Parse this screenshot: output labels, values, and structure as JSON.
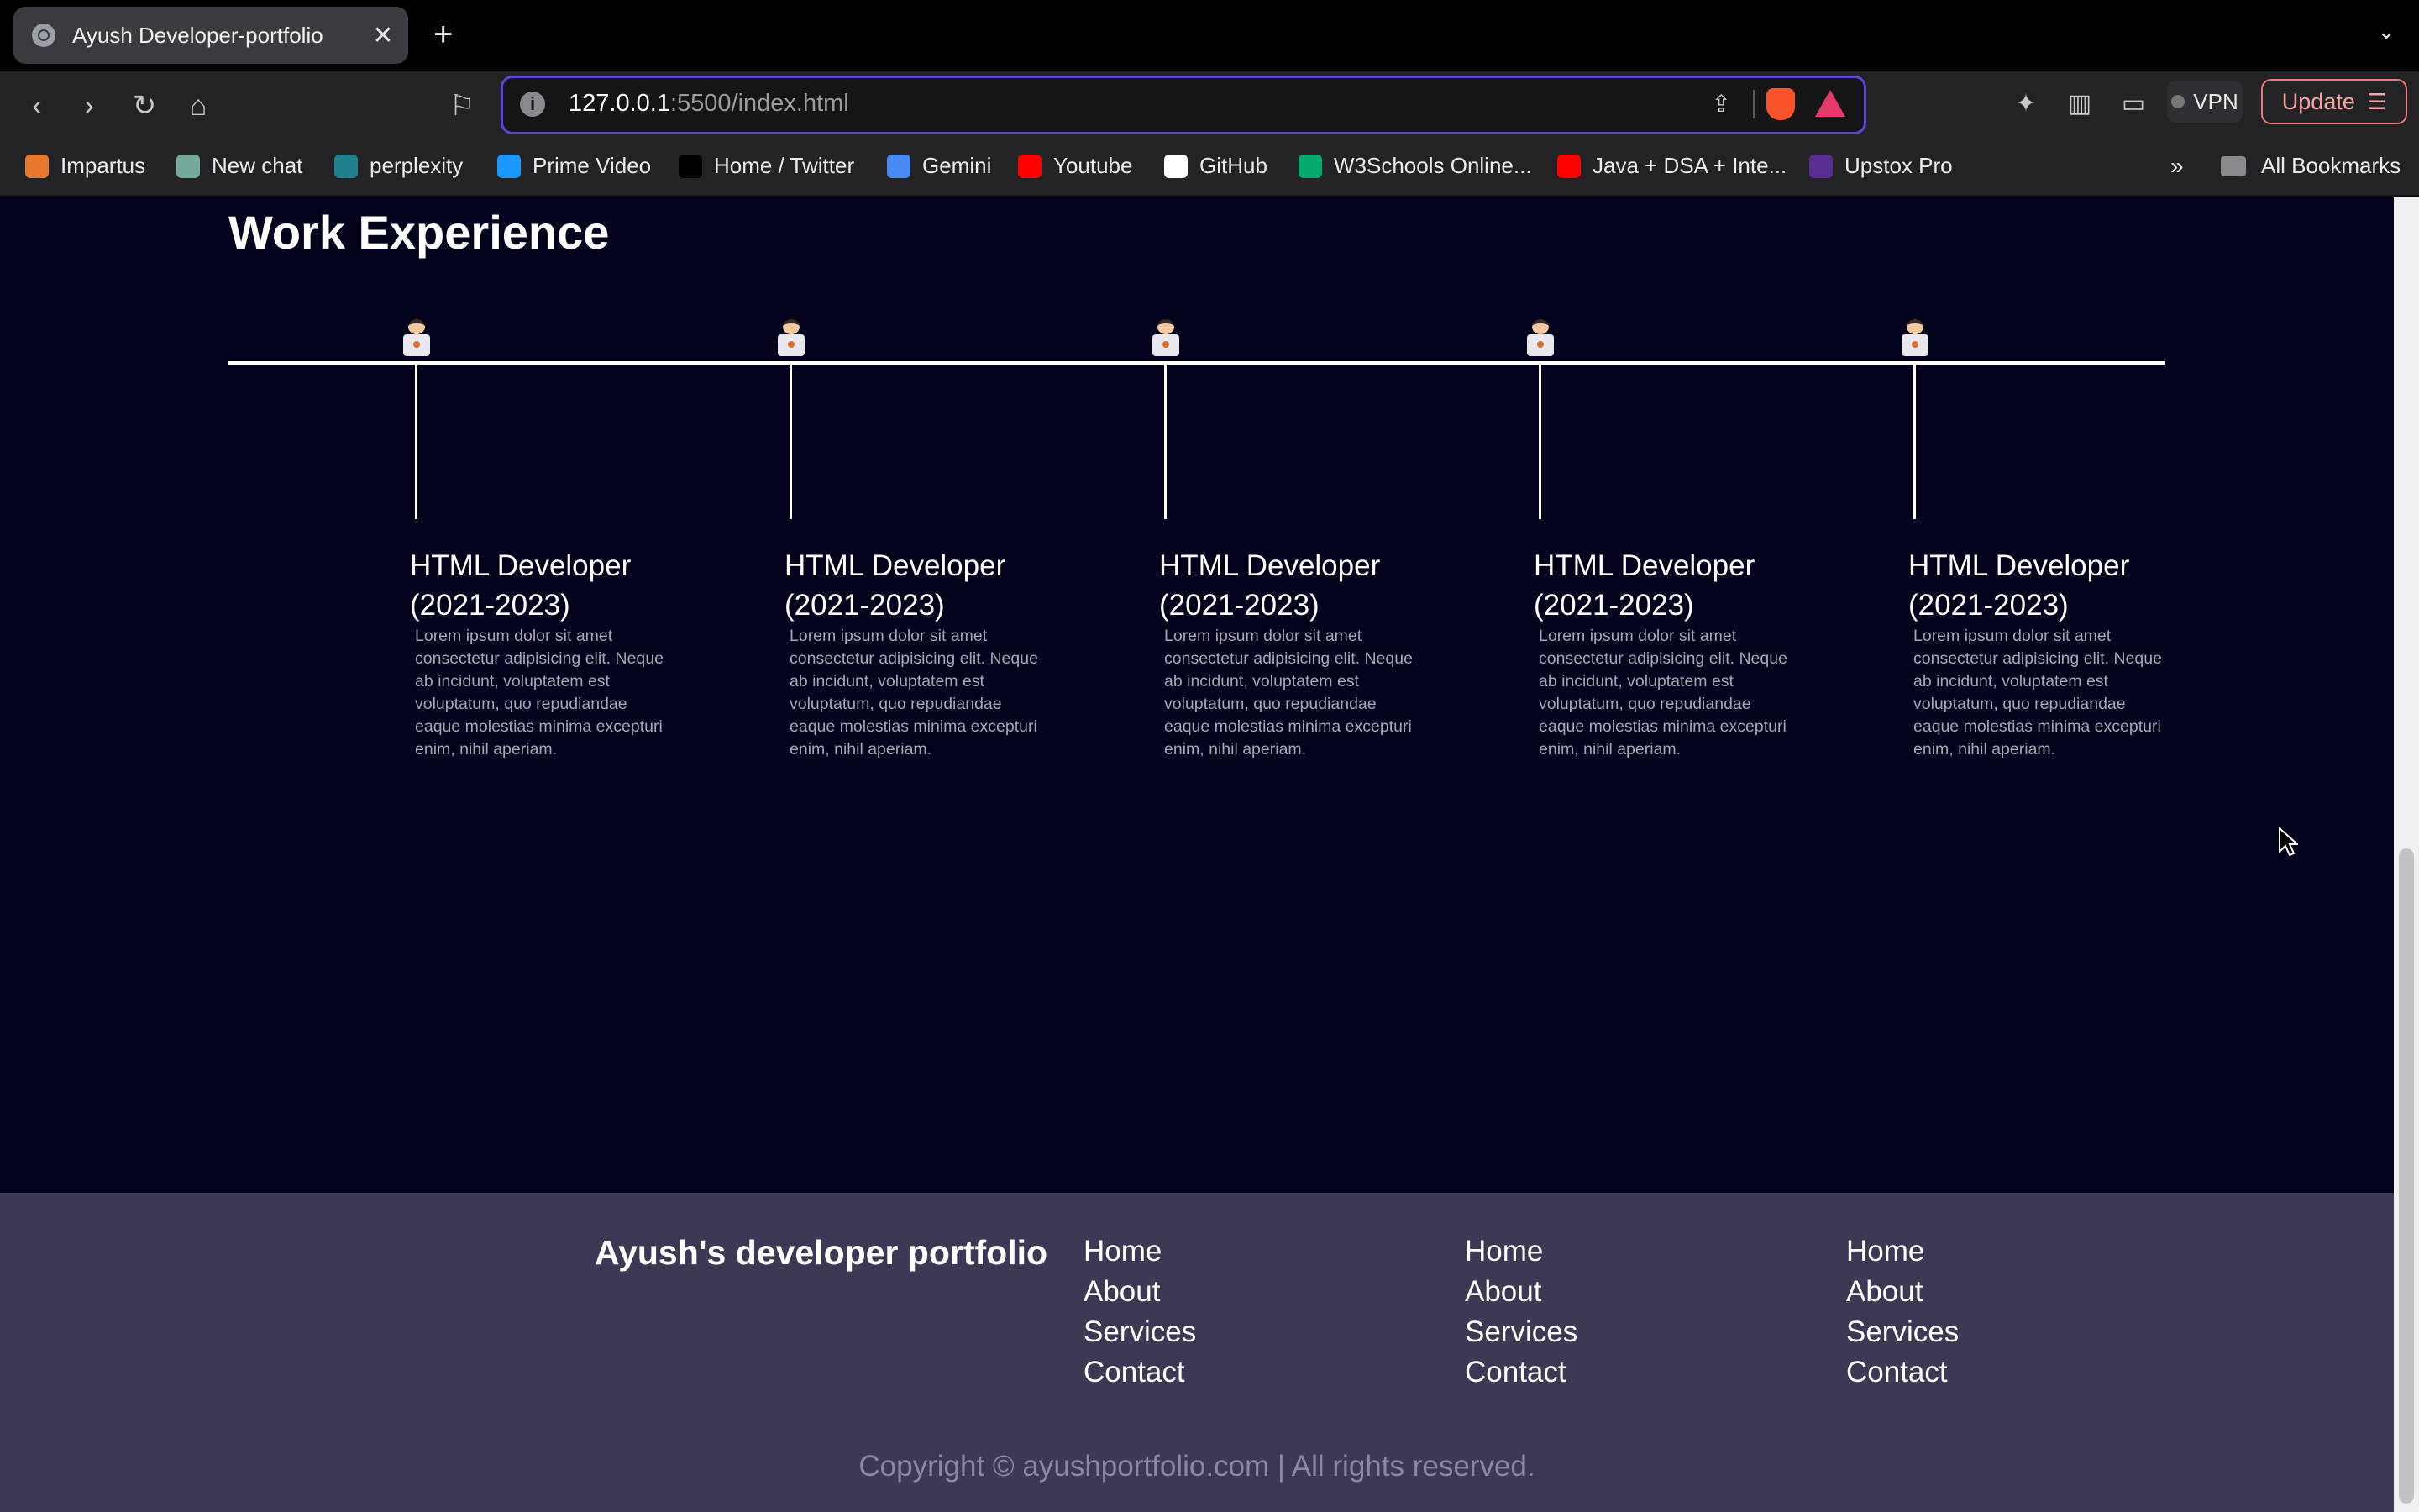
{
  "browser": {
    "tab_title": "Ayush Developer-portfolio",
    "url_host": "127.0.0.1",
    "url_rest": ":5500/index.html",
    "vpn_label": "VPN",
    "update_label": "Update"
  },
  "bookmarks": {
    "items": [
      {
        "label": "Impartus",
        "color": "#e8772e"
      },
      {
        "label": "New chat",
        "color": "#74aa9c"
      },
      {
        "label": "perplexity",
        "color": "#20808d"
      },
      {
        "label": "Prime Video",
        "color": "#1a98ff"
      },
      {
        "label": "Home / Twitter",
        "color": "#000000"
      },
      {
        "label": "Gemini",
        "color": "#4a8af4"
      },
      {
        "label": "Youtube",
        "color": "#ff0000"
      },
      {
        "label": "GitHub",
        "color": "#ffffff"
      },
      {
        "label": "W3Schools Online...",
        "color": "#04aa6d"
      },
      {
        "label": "Java + DSA + Inte...",
        "color": "#ff0000"
      },
      {
        "label": "Upstox Pro",
        "color": "#5a2d91"
      }
    ],
    "more_label": "»",
    "all_label": "All Bookmarks"
  },
  "work": {
    "title": "Work Experience",
    "items": [
      {
        "role_line1": "HTML Developer",
        "role_line2": "(2021-2023)",
        "desc": "Lorem ipsum dolor sit amet consectetur adipisicing elit. Neque ab incidunt, voluptatem est voluptatum, quo repudiandae eaque molestias minima excepturi enim, nihil aperiam."
      },
      {
        "role_line1": "HTML Developer",
        "role_line2": "(2021-2023)",
        "desc": "Lorem ipsum dolor sit amet consectetur adipisicing elit. Neque ab incidunt, voluptatem est voluptatum, quo repudiandae eaque molestias minima excepturi enim, nihil aperiam."
      },
      {
        "role_line1": "HTML Developer",
        "role_line2": "(2021-2023)",
        "desc": "Lorem ipsum dolor sit amet consectetur adipisicing elit. Neque ab incidunt, voluptatem est voluptatum, quo repudiandae eaque molestias minima excepturi enim, nihil aperiam."
      },
      {
        "role_line1": "HTML Developer",
        "role_line2": "(2021-2023)",
        "desc": "Lorem ipsum dolor sit amet consectetur adipisicing elit. Neque ab incidunt, voluptatem est voluptatum, quo repudiandae eaque molestias minima excepturi enim, nihil aperiam."
      },
      {
        "role_line1": "HTML Developer",
        "role_line2": "(2021-2023)",
        "desc": "Lorem ipsum dolor sit amet consectetur adipisicing elit. Neque ab incidunt, voluptatem est voluptatum, quo repudiandae eaque molestias minima excepturi enim, nihil aperiam."
      }
    ]
  },
  "footer": {
    "brand": "Ayush's developer portfolio",
    "columns": [
      {
        "links": [
          "Home",
          "About",
          "Services",
          "Contact"
        ]
      },
      {
        "links": [
          "Home",
          "About",
          "Services",
          "Contact"
        ]
      },
      {
        "links": [
          "Home",
          "About",
          "Services",
          "Contact"
        ]
      }
    ],
    "copyright": "Copyright © ayushportfolio.com | All rights reserved."
  }
}
